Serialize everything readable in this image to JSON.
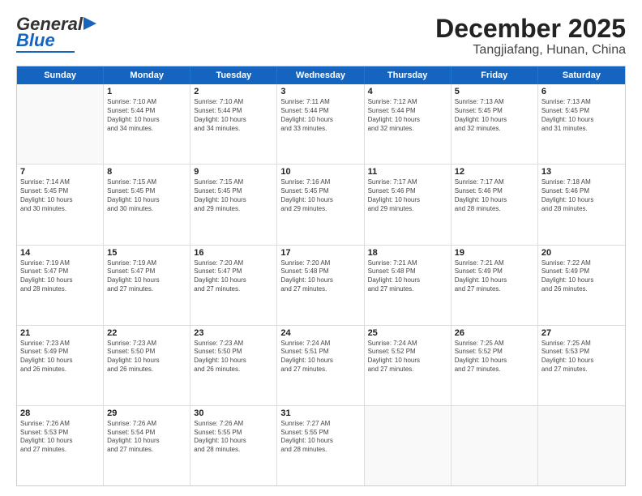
{
  "header": {
    "logo_general": "General",
    "logo_blue": "Blue",
    "title": "December 2025",
    "subtitle": "Tangjiafang, Hunan, China"
  },
  "days": [
    "Sunday",
    "Monday",
    "Tuesday",
    "Wednesday",
    "Thursday",
    "Friday",
    "Saturday"
  ],
  "weeks": [
    [
      {
        "day": "",
        "info": ""
      },
      {
        "day": "1",
        "info": "Sunrise: 7:10 AM\nSunset: 5:44 PM\nDaylight: 10 hours\nand 34 minutes."
      },
      {
        "day": "2",
        "info": "Sunrise: 7:10 AM\nSunset: 5:44 PM\nDaylight: 10 hours\nand 34 minutes."
      },
      {
        "day": "3",
        "info": "Sunrise: 7:11 AM\nSunset: 5:44 PM\nDaylight: 10 hours\nand 33 minutes."
      },
      {
        "day": "4",
        "info": "Sunrise: 7:12 AM\nSunset: 5:44 PM\nDaylight: 10 hours\nand 32 minutes."
      },
      {
        "day": "5",
        "info": "Sunrise: 7:13 AM\nSunset: 5:45 PM\nDaylight: 10 hours\nand 32 minutes."
      },
      {
        "day": "6",
        "info": "Sunrise: 7:13 AM\nSunset: 5:45 PM\nDaylight: 10 hours\nand 31 minutes."
      }
    ],
    [
      {
        "day": "7",
        "info": "Sunrise: 7:14 AM\nSunset: 5:45 PM\nDaylight: 10 hours\nand 30 minutes."
      },
      {
        "day": "8",
        "info": "Sunrise: 7:15 AM\nSunset: 5:45 PM\nDaylight: 10 hours\nand 30 minutes."
      },
      {
        "day": "9",
        "info": "Sunrise: 7:15 AM\nSunset: 5:45 PM\nDaylight: 10 hours\nand 29 minutes."
      },
      {
        "day": "10",
        "info": "Sunrise: 7:16 AM\nSunset: 5:45 PM\nDaylight: 10 hours\nand 29 minutes."
      },
      {
        "day": "11",
        "info": "Sunrise: 7:17 AM\nSunset: 5:46 PM\nDaylight: 10 hours\nand 29 minutes."
      },
      {
        "day": "12",
        "info": "Sunrise: 7:17 AM\nSunset: 5:46 PM\nDaylight: 10 hours\nand 28 minutes."
      },
      {
        "day": "13",
        "info": "Sunrise: 7:18 AM\nSunset: 5:46 PM\nDaylight: 10 hours\nand 28 minutes."
      }
    ],
    [
      {
        "day": "14",
        "info": "Sunrise: 7:19 AM\nSunset: 5:47 PM\nDaylight: 10 hours\nand 28 minutes."
      },
      {
        "day": "15",
        "info": "Sunrise: 7:19 AM\nSunset: 5:47 PM\nDaylight: 10 hours\nand 27 minutes."
      },
      {
        "day": "16",
        "info": "Sunrise: 7:20 AM\nSunset: 5:47 PM\nDaylight: 10 hours\nand 27 minutes."
      },
      {
        "day": "17",
        "info": "Sunrise: 7:20 AM\nSunset: 5:48 PM\nDaylight: 10 hours\nand 27 minutes."
      },
      {
        "day": "18",
        "info": "Sunrise: 7:21 AM\nSunset: 5:48 PM\nDaylight: 10 hours\nand 27 minutes."
      },
      {
        "day": "19",
        "info": "Sunrise: 7:21 AM\nSunset: 5:49 PM\nDaylight: 10 hours\nand 27 minutes."
      },
      {
        "day": "20",
        "info": "Sunrise: 7:22 AM\nSunset: 5:49 PM\nDaylight: 10 hours\nand 26 minutes."
      }
    ],
    [
      {
        "day": "21",
        "info": "Sunrise: 7:23 AM\nSunset: 5:49 PM\nDaylight: 10 hours\nand 26 minutes."
      },
      {
        "day": "22",
        "info": "Sunrise: 7:23 AM\nSunset: 5:50 PM\nDaylight: 10 hours\nand 26 minutes."
      },
      {
        "day": "23",
        "info": "Sunrise: 7:23 AM\nSunset: 5:50 PM\nDaylight: 10 hours\nand 26 minutes."
      },
      {
        "day": "24",
        "info": "Sunrise: 7:24 AM\nSunset: 5:51 PM\nDaylight: 10 hours\nand 27 minutes."
      },
      {
        "day": "25",
        "info": "Sunrise: 7:24 AM\nSunset: 5:52 PM\nDaylight: 10 hours\nand 27 minutes."
      },
      {
        "day": "26",
        "info": "Sunrise: 7:25 AM\nSunset: 5:52 PM\nDaylight: 10 hours\nand 27 minutes."
      },
      {
        "day": "27",
        "info": "Sunrise: 7:25 AM\nSunset: 5:53 PM\nDaylight: 10 hours\nand 27 minutes."
      }
    ],
    [
      {
        "day": "28",
        "info": "Sunrise: 7:26 AM\nSunset: 5:53 PM\nDaylight: 10 hours\nand 27 minutes."
      },
      {
        "day": "29",
        "info": "Sunrise: 7:26 AM\nSunset: 5:54 PM\nDaylight: 10 hours\nand 27 minutes."
      },
      {
        "day": "30",
        "info": "Sunrise: 7:26 AM\nSunset: 5:55 PM\nDaylight: 10 hours\nand 28 minutes."
      },
      {
        "day": "31",
        "info": "Sunrise: 7:27 AM\nSunset: 5:55 PM\nDaylight: 10 hours\nand 28 minutes."
      },
      {
        "day": "",
        "info": ""
      },
      {
        "day": "",
        "info": ""
      },
      {
        "day": "",
        "info": ""
      }
    ]
  ]
}
